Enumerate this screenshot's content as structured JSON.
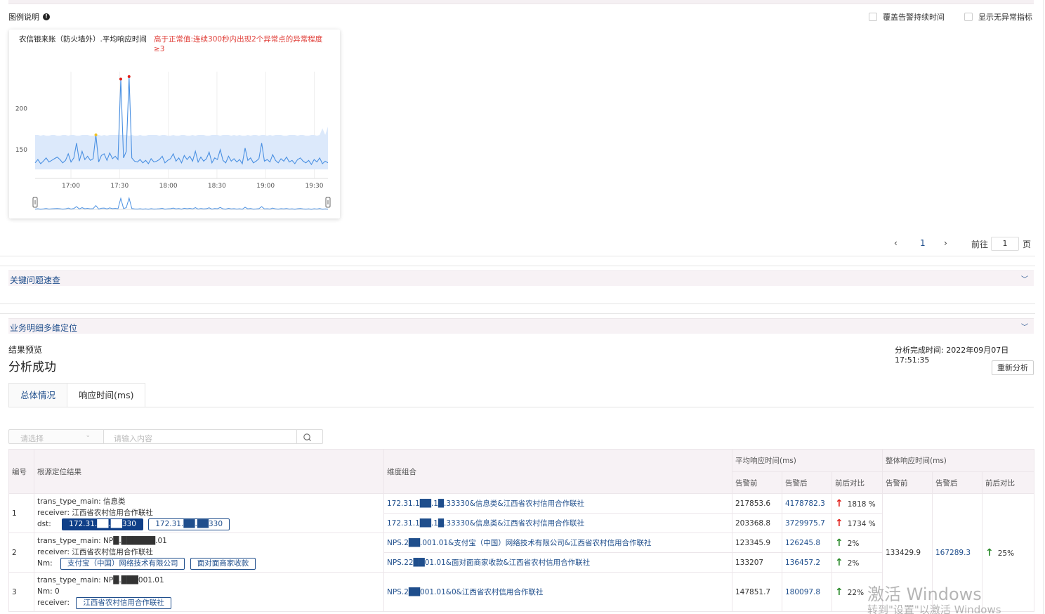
{
  "legend": {
    "title": "图例说明",
    "info_icon": "info-icon"
  },
  "options": {
    "cover_alarm_duration": "覆盖告警持续时间",
    "show_no_anomaly": "显示无异常指标"
  },
  "chart_card": {
    "title": "农信银来账（防火墙外）.平均响应时间",
    "warning": "高于正常值:连续300秒内出现2个异常点的异常程度≥3"
  },
  "chart_data": {
    "type": "line",
    "x_ticks": [
      "17:00",
      "17:30",
      "18:00",
      "18:30",
      "19:00",
      "19:30"
    ],
    "y_ticks": [
      150,
      200
    ],
    "ylim": [
      115,
      245
    ],
    "line_color": "#4a90e2",
    "band_color": "#dce9fb",
    "series": [
      {
        "values": [
          134,
          138,
          133,
          136,
          140,
          135,
          137,
          139,
          141,
          138,
          134,
          137,
          145,
          135,
          140,
          158,
          136,
          148,
          138,
          142,
          137,
          139,
          168,
          135,
          143,
          145,
          137,
          146,
          139,
          142,
          138,
          236,
          140,
          148,
          239,
          140,
          136,
          135,
          138,
          134,
          137,
          133,
          139,
          135,
          136,
          138,
          142,
          134,
          137,
          139,
          145,
          136,
          140,
          134,
          143,
          138,
          142,
          136,
          148,
          135,
          141,
          136,
          139,
          147,
          134,
          140,
          138,
          150,
          137,
          134,
          142,
          136,
          139,
          135,
          138,
          133,
          152,
          137,
          140,
          134,
          136,
          139,
          158,
          136,
          138,
          135,
          144,
          137,
          134,
          139,
          136,
          141,
          135,
          137,
          133,
          138,
          140,
          136,
          134,
          137,
          132,
          138,
          135,
          140,
          133,
          136,
          134
        ]
      }
    ],
    "band_upper": [
      168,
      168,
      167,
      168,
      167,
      167,
      168,
      168,
      167,
      167,
      168,
      168,
      167,
      168,
      168,
      167,
      167,
      168,
      168,
      168,
      167,
      167,
      168,
      168,
      167,
      168,
      167,
      168,
      168,
      168,
      168,
      168,
      168,
      168,
      167,
      168,
      167,
      167,
      168,
      167,
      167,
      168,
      168,
      168,
      168,
      167,
      168,
      168,
      167,
      167,
      168,
      167,
      167,
      168,
      168,
      167,
      167,
      168,
      167,
      168,
      168,
      168,
      167,
      167,
      168,
      168,
      168,
      167,
      168,
      168,
      168,
      167,
      168,
      167,
      168,
      167,
      167,
      168,
      167,
      168,
      168,
      167,
      168,
      168,
      167,
      168,
      167,
      168,
      168,
      168,
      167,
      167,
      168,
      168,
      168,
      167,
      168,
      168,
      167,
      167,
      168,
      168,
      167,
      168,
      176,
      168,
      178
    ],
    "band_lower": [
      126,
      126,
      126,
      126,
      126,
      126,
      126,
      126,
      126,
      126,
      126,
      126,
      126,
      126,
      126,
      126,
      126,
      126,
      126,
      126,
      126,
      126,
      126,
      126,
      126,
      126,
      126,
      126,
      126,
      126,
      126,
      126,
      126,
      126,
      126,
      126,
      126,
      126,
      126,
      126,
      126,
      126,
      126,
      126,
      126,
      126,
      126,
      126,
      126,
      126,
      126,
      126,
      126,
      126,
      126,
      126,
      126,
      126,
      126,
      126,
      126,
      126,
      126,
      126,
      126,
      126,
      126,
      126,
      126,
      126,
      126,
      126,
      126,
      126,
      126,
      126,
      126,
      126,
      126,
      126,
      126,
      126,
      126,
      126,
      126,
      126,
      126,
      126,
      126,
      126,
      126,
      126,
      126,
      126,
      126,
      126,
      126,
      126,
      126,
      126,
      126,
      126,
      126,
      126,
      126,
      126,
      126
    ],
    "anomaly_points": [
      {
        "index": 31,
        "color": "#e0201a"
      },
      {
        "index": 34,
        "color": "#e0201a"
      },
      {
        "index": 22,
        "color": "#f0c020"
      }
    ]
  },
  "pagination": {
    "prev": "‹",
    "current": "1",
    "next": "›",
    "goto_label": "前往",
    "goto_value": "1",
    "page_unit": "页"
  },
  "sections": {
    "key_issue": "关键问题速查",
    "multi_dim": "业务明细多维定位",
    "chevron": "﹀"
  },
  "result": {
    "preview_label": "结果预览",
    "status": "分析成功",
    "finish_time": "分析完成时间: 2022年09月07日 17:51:35",
    "reanalyze": "重新分析",
    "tabs": [
      "总体情况",
      "响应时间(ms)"
    ]
  },
  "filter": {
    "select_placeholder": "请选择",
    "search_placeholder": "请输入内容",
    "select_chevron": "⌄"
  },
  "table": {
    "headers": {
      "no": "编号",
      "root": "根源定位结果",
      "dims": "维度组合",
      "avg_group": "平均响应时间(ms)",
      "overall_group": "整体响应时间(ms)",
      "before": "告警前",
      "after": "告警后",
      "compare": "前后对比"
    },
    "overall": {
      "before": "133429.9",
      "after": "167289.3",
      "compare": "25%"
    },
    "rows": [
      {
        "no": "1",
        "root": [
          "trans_type_main: 信息类",
          "receiver: 江西省农村信用合作联社",
          "dst:"
        ],
        "tags": [
          "172.31.██.██330",
          "172.31.██.██330"
        ],
        "sub": [
          {
            "dim": "172.31.1██.1█.33330&信息类&江西省农村信用合作联社",
            "before": "217853.6",
            "after": "4178782.3",
            "compare": "1818 %"
          },
          {
            "dim": "172.31.1██.1█.33330&信息类&江西省农村信用合作联社",
            "before": "203368.8",
            "after": "3729975.7",
            "compare": "1734 %"
          }
        ]
      },
      {
        "no": "2",
        "root": [
          "trans_type_main: NP█.██████.01",
          "receiver: 江西省农村信用合作联社",
          "Nm:"
        ],
        "tags": [
          "支付宝（中国）网络技术有限公司",
          "面对面商家收款"
        ],
        "sub": [
          {
            "dim": "NPS.2██.001.01&支付宝（中国）网络技术有限公司&江西省农村信用合作联社",
            "before": "123345.9",
            "after": "126245.8",
            "compare": "2%"
          },
          {
            "dim": "NPS.22██01.01&面对面商家收款&江西省农村信用合作联社",
            "before": "133207",
            "after": "136457.2",
            "compare": "2%"
          }
        ]
      },
      {
        "no": "3",
        "root": [
          "trans_type_main: NP█.███001.01",
          "Nm: 0",
          "receiver:"
        ],
        "tags": [
          "江西省农村信用合作联社"
        ],
        "sub": [
          {
            "dim": "NPS.2██001.01&0&江西省农村信用合作联社",
            "before": "147851.7",
            "after": "180097.8",
            "compare": "22%"
          }
        ]
      }
    ]
  },
  "watermark": {
    "line1": "激活 Windows",
    "line2": "转到\"设置\"以激活 Windows"
  }
}
